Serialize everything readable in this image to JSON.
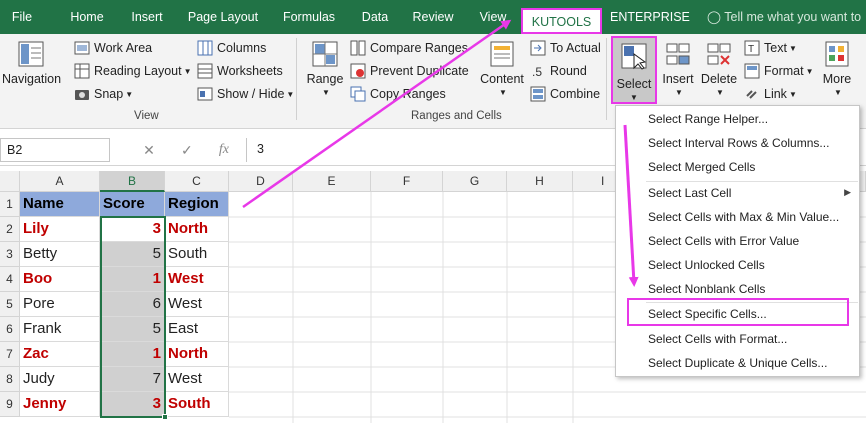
{
  "tabs": [
    "File",
    "Home",
    "Insert",
    "Page Layout",
    "Formulas",
    "Data",
    "Review",
    "View",
    "KUTOOLS",
    "ENTERPRISE"
  ],
  "tell_me": "Tell me what you want to",
  "ribbon": {
    "navigation": "Navigation",
    "view_group": {
      "work_area": "Work Area",
      "reading_layout": "Reading Layout",
      "snap": "Snap",
      "columns": "Columns",
      "worksheets": "Worksheets",
      "show_hide": "Show / Hide",
      "label": "View"
    },
    "ranges_group": {
      "range": "Range",
      "compare_ranges": "Compare Ranges",
      "prevent_duplicate": "Prevent Duplicate",
      "copy_ranges": "Copy Ranges",
      "content": "Content",
      "to_actual": "To Actual",
      "round": "Round",
      "combine": "Combine",
      "label": "Ranges and Cells"
    },
    "select": "Select",
    "insert": "Insert",
    "delete": "Delete",
    "text": "Text",
    "format": "Format",
    "link": "Link",
    "more": "More"
  },
  "formula_bar": {
    "name_box": "B2",
    "formula": "3",
    "fx": "fx"
  },
  "columns": [
    "A",
    "B",
    "C",
    "D",
    "E",
    "F",
    "G",
    "H",
    "I"
  ],
  "rows": [
    "1",
    "2",
    "3",
    "4",
    "5",
    "6",
    "7",
    "8",
    "9"
  ],
  "table": {
    "headers": [
      "Name",
      "Score",
      "Region"
    ],
    "rows": [
      {
        "name": "Lily",
        "score": "3",
        "region": "North"
      },
      {
        "name": "Betty",
        "score": "5",
        "region": "South"
      },
      {
        "name": "Boo",
        "score": "1",
        "region": "West"
      },
      {
        "name": "Pore",
        "score": "6",
        "region": "West"
      },
      {
        "name": "Frank",
        "score": "5",
        "region": "East"
      },
      {
        "name": "Zac",
        "score": "1",
        "region": "North"
      },
      {
        "name": "Judy",
        "score": "7",
        "region": "West"
      },
      {
        "name": "Jenny",
        "score": "3",
        "region": "South"
      }
    ]
  },
  "dropdown": [
    "Select Range Helper...",
    "Select Interval Rows & Columns...",
    "Select Merged Cells",
    "Select Last Cell",
    "Select Cells with Max & Min Value...",
    "Select Cells with Error Value",
    "Select Unlocked Cells",
    "Select Nonblank Cells",
    "Select Specific Cells...",
    "Select Cells with Format...",
    "Select Duplicate & Unique Cells..."
  ],
  "colors": {
    "tab_bar": "#217346",
    "highlight": "#e838e8",
    "header_fill": "#8ea9db",
    "red_text": "#c00000"
  }
}
